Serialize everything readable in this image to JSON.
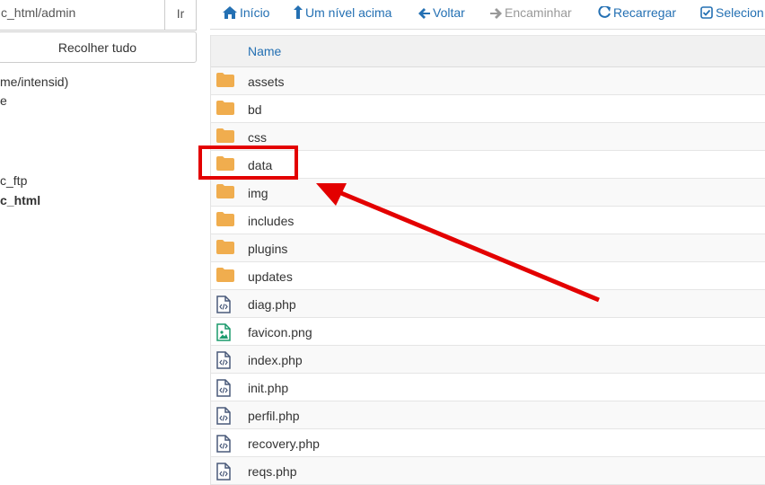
{
  "left_pane": {
    "path_value": "c_html/admin",
    "go_label": "Ir",
    "collapse_label": "Recolher tudo",
    "tree": [
      "me/intensid)",
      "e",
      "c_ftp",
      "c_html"
    ]
  },
  "toolbar": {
    "home": "Início",
    "up": "Um nível acima",
    "back": "Voltar",
    "forward": "Encaminhar",
    "reload": "Recarregar",
    "select": "Selecion"
  },
  "table": {
    "col_name": "Name",
    "rows": [
      {
        "name": "assets",
        "type": "folder"
      },
      {
        "name": "bd",
        "type": "folder"
      },
      {
        "name": "css",
        "type": "folder"
      },
      {
        "name": "data",
        "type": "folder"
      },
      {
        "name": "img",
        "type": "folder"
      },
      {
        "name": "includes",
        "type": "folder"
      },
      {
        "name": "plugins",
        "type": "folder"
      },
      {
        "name": "updates",
        "type": "folder"
      },
      {
        "name": "diag.php",
        "type": "code"
      },
      {
        "name": "favicon.png",
        "type": "image"
      },
      {
        "name": "index.php",
        "type": "code"
      },
      {
        "name": "init.php",
        "type": "code"
      },
      {
        "name": "perfil.php",
        "type": "code"
      },
      {
        "name": "recovery.php",
        "type": "code"
      },
      {
        "name": "reqs.php",
        "type": "code"
      }
    ]
  },
  "colors": {
    "link": "#2470b3",
    "folder": "#f0ad4e",
    "annotation": "#e30000",
    "image_icon": "#1a9a6c"
  },
  "icons": [
    "home-icon",
    "arrow-up-icon",
    "arrow-left-icon",
    "arrow-right-icon",
    "refresh-icon",
    "check-square-icon",
    "folder-icon",
    "code-file-icon",
    "image-file-icon"
  ]
}
